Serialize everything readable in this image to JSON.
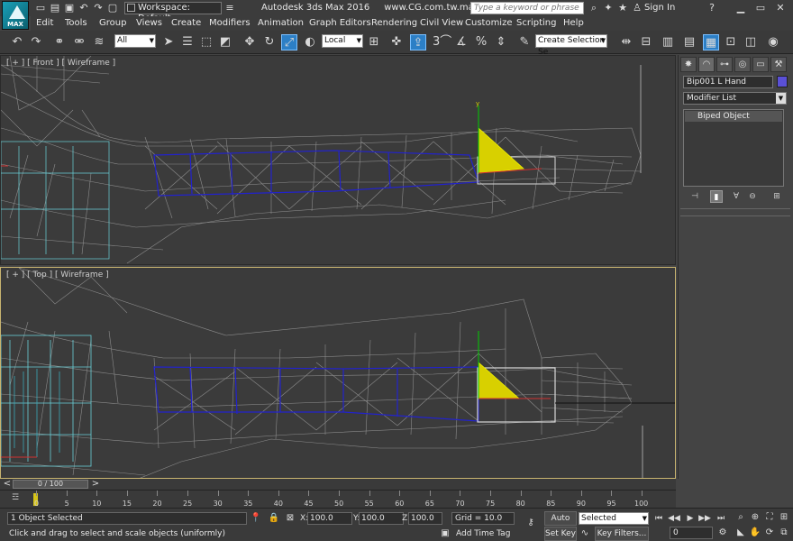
{
  "title_bar": {
    "app_title": "Autodesk 3ds Max 2016",
    "file_name": "www.CG.com.tw.max",
    "workspace_label": "Workspace: Default",
    "search_placeholder": "Type a keyword or phrase",
    "sign_in": "Sign In",
    "logo_text": "MAX"
  },
  "menu": {
    "items": [
      "Edit",
      "Tools",
      "Group",
      "Views",
      "Create",
      "Modifiers",
      "Animation",
      "Graph Editors",
      "Rendering",
      "Civil View",
      "Customize",
      "Scripting",
      "Help"
    ]
  },
  "toolbar": {
    "selection_filter": "All",
    "reference_coord": "Local",
    "snap_label": "3",
    "selection_set_placeholder": "Create Selection Se"
  },
  "viewports": {
    "front_label": "[ + ] [ Front ] [ Wireframe ]",
    "top_label": "[ + ] [ Top ] [ Wireframe ]",
    "gizmo_axis": "y"
  },
  "command_panel": {
    "object_name": "Bip001 L Hand",
    "object_color": "#5a50d6",
    "modifier_list": "Modifier List",
    "stack_item": "Biped Object"
  },
  "timeline": {
    "time_slider": "0 / 100",
    "ticks": [
      0,
      5,
      10,
      15,
      20,
      25,
      30,
      35,
      40,
      45,
      50,
      55,
      60,
      65,
      70,
      75,
      80,
      85,
      90,
      95,
      100
    ]
  },
  "status": {
    "selection_count": "1 Object Selected",
    "prompt": "Click and drag to select and scale objects (uniformly)",
    "x_label": "X:",
    "x_value": "100.0",
    "y_label": "Y:",
    "y_value": "100.0",
    "z_label": "Z:",
    "z_value": "100.0",
    "grid": "Grid = 10.0",
    "add_time_tag": "Add Time Tag",
    "auto_key": "Auto Key",
    "set_key": "Set Key",
    "key_mode": "Selected",
    "key_filters": "Key Filters...",
    "current_frame": "0"
  }
}
